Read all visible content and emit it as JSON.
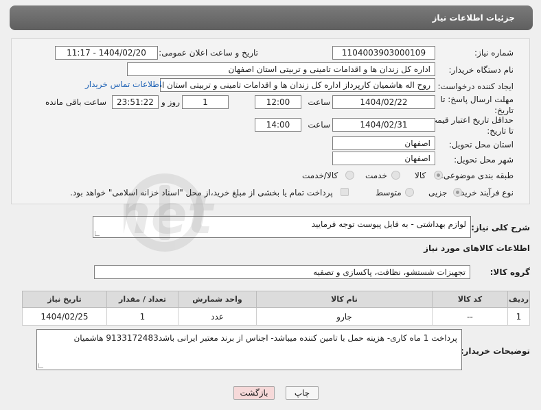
{
  "header": {
    "title": "جزئیات اطلاعات نیاز"
  },
  "form": {
    "need_number_label": "شماره نیاز:",
    "need_number": "1104003903000109",
    "announce_label": "تاریخ و ساعت اعلان عمومی:",
    "announce_value": "1404/02/20 - 11:17",
    "buyer_org_label": "نام دستگاه خریدار:",
    "buyer_org": "اداره کل زندان ها و اقدامات تامینی و تربیتی استان اصفهان",
    "creator_label": "ایجاد کننده درخواست:",
    "creator": "روح اله هاشمیان کارپرداز اداره کل زندان ها و اقدامات تامینی و تربیتی استان اصفهان",
    "contact_link": "اطلاعات تماس خریدار",
    "reply_deadline_label": "مهلت ارسال پاسخ: تا تاریخ:",
    "reply_date": "1404/02/22",
    "time_label": "ساعت",
    "reply_time": "12:00",
    "days_count": "1",
    "days_label": "روز و",
    "remaining_time": "23:51:22",
    "remaining_label": "ساعت باقی مانده",
    "min_price_label": "حداقل تاریخ اعتبار قیمت: تا تاریخ:",
    "price_date": "1404/02/31",
    "price_time": "14:00",
    "province_label": "استان محل تحویل:",
    "province": "اصفهان",
    "city_label": "شهر محل تحویل:",
    "city": "اصفهان",
    "category_label": "طبقه بندی موضوعی:",
    "category_options": [
      "کالا",
      "خدمت",
      "کالا/خدمت"
    ],
    "process_label": "نوع فرآیند خرید :",
    "process_options": [
      "جزیی",
      "متوسط"
    ],
    "payment_note": "پرداخت تمام یا بخشی از مبلغ خرید،از محل \"اسناد خزانه اسلامی\" خواهد بود."
  },
  "summary": {
    "label": "شرح کلی نیاز:",
    "value": "لوازم بهداشتی - به فایل پیوست توجه فرمایید"
  },
  "goods_info_title": "اطلاعات کالاهای مورد نیاز",
  "goods_group": {
    "label": "گروه کالا:",
    "value": "تجهیزات شستشو، نظافت، پاکسازی و تصفیه"
  },
  "table": {
    "headers": [
      "ردیف",
      "کد کالا",
      "نام کالا",
      "واحد شمارش",
      "تعداد / مقدار",
      "تاریخ نیاز"
    ],
    "rows": [
      [
        "1",
        "--",
        "جارو",
        "عدد",
        "1",
        "1404/02/25"
      ]
    ]
  },
  "buyer_notes": {
    "label": "توضیحات خریدار:",
    "value": "پرداخت 1 ماه کاری- هزینه حمل با تامین کننده میباشد- اجناس از برند معتبر  ایرانی باشد9133172483 هاشمیان"
  },
  "buttons": {
    "print": "چاپ",
    "back": "بازگشت"
  },
  "watermark_text": "AriaTender.net"
}
